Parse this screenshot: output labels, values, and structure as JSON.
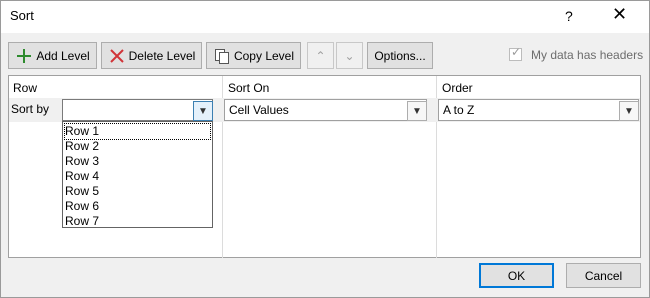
{
  "title": "Sort",
  "help_glyph": "?",
  "close_glyph": "✕",
  "toolbar": {
    "add_level": "Add Level",
    "delete_level": "Delete Level",
    "copy_level": "Copy Level",
    "move_up_glyph": "⌃",
    "move_down_glyph": "⌄",
    "options": "Options...",
    "headers_label": "My data has headers",
    "headers_checked": true
  },
  "columns": {
    "row": "Row",
    "sort_on": "Sort On",
    "order": "Order"
  },
  "level": {
    "label": "Sort by",
    "column_value": "",
    "sort_on_value": "Cell Values",
    "order_value": "A to Z"
  },
  "dropdown_options": [
    "Row 1",
    "Row 2",
    "Row 3",
    "Row 4",
    "Row 5",
    "Row 6",
    "Row 7"
  ],
  "footer": {
    "ok": "OK",
    "cancel": "Cancel"
  },
  "colors": {
    "accent_green": "#2e8b2e",
    "delete_red": "#d13438",
    "ok_border": "#0078d7"
  }
}
